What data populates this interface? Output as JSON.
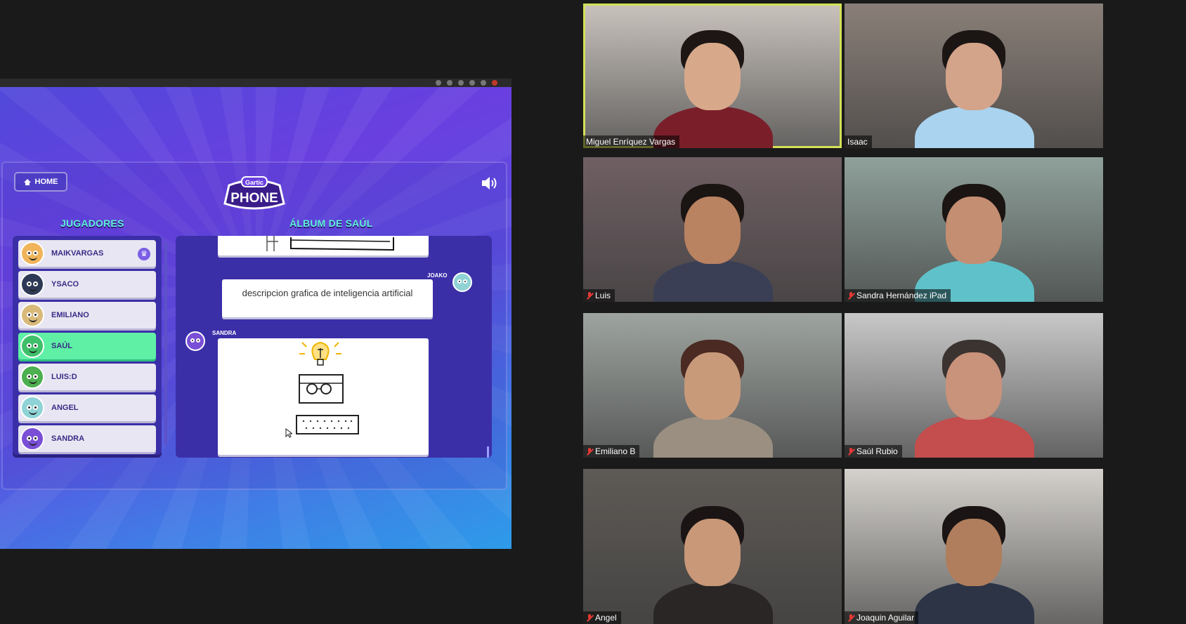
{
  "shared_screen": {
    "home_label": "HOME",
    "logo_top": "Gartic",
    "logo_bottom": "PHONE",
    "players_title": "JUGADORES",
    "album_title": "ÁLBUM DE SAÚL",
    "players": [
      {
        "name": "MAIKVARGAS",
        "host": true,
        "color": "#f0b45a"
      },
      {
        "name": "YSACO",
        "host": false,
        "color": "#2e3a55"
      },
      {
        "name": "EMILIANO",
        "host": false,
        "color": "#d9b97a"
      },
      {
        "name": "SAÚL",
        "host": false,
        "color": "#3fbf6a"
      },
      {
        "name": "LUIS:D",
        "host": false,
        "color": "#4caf50"
      },
      {
        "name": "ANGEL",
        "host": false,
        "color": "#8fd3d6"
      },
      {
        "name": "SANDRA",
        "host": false,
        "color": "#7a4fd6"
      }
    ],
    "album": {
      "text_author": "JOAKO",
      "text_entry": "descripcion grafica de inteligencia artificial",
      "drawing_author": "SANDRA"
    }
  },
  "participants": [
    {
      "name": "Miguel Enríquez Vargas",
      "muted": false,
      "speaking": true,
      "bg": "#c9c3bd",
      "skin": "#d7a98a",
      "shirt": "#7a1f2a",
      "hair": "#1d1614"
    },
    {
      "name": "Isaac",
      "muted": false,
      "speaking": false,
      "bg": "#8a7f78",
      "skin": "#d4a48a",
      "shirt": "#a9d3ef",
      "hair": "#1b1614"
    },
    {
      "name": "Luis",
      "muted": true,
      "speaking": false,
      "bg": "#6f5f63",
      "skin": "#b98261",
      "shirt": "#3b3f55",
      "hair": "#1a1412"
    },
    {
      "name": "Sandra Hernández iPad",
      "muted": true,
      "speaking": false,
      "bg": "#8fa09a",
      "skin": "#c48e72",
      "shirt": "#5fc1c9",
      "hair": "#1a1412"
    },
    {
      "name": "Emiliano B",
      "muted": true,
      "speaking": false,
      "bg": "#9ea4a0",
      "skin": "#c99a7a",
      "shirt": "#9a8f80",
      "hair": "#4a2a22"
    },
    {
      "name": "Saúl Rubio",
      "muted": true,
      "speaking": false,
      "bg": "#c8c8c8",
      "skin": "#c9927a",
      "shirt": "#c44d4d",
      "hair": "#3a3330"
    },
    {
      "name": "Angel",
      "muted": true,
      "speaking": false,
      "bg": "#5e5a56",
      "skin": "#c99878",
      "shirt": "#2a2626",
      "hair": "#1a1414"
    },
    {
      "name": "Joaquin Aguilar",
      "muted": true,
      "speaking": false,
      "bg": "#d4d1cc",
      "skin": "#b07e5c",
      "shirt": "#2c3446",
      "hair": "#1a1414"
    }
  ]
}
